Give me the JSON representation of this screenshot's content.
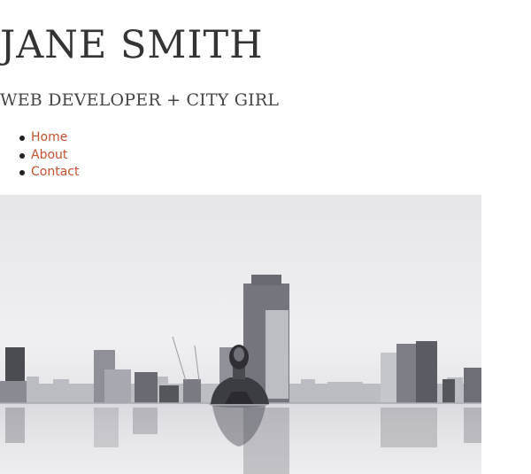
{
  "header": {
    "title": "JANE SMITH",
    "tagline": "WEB DEVELOPER + CITY GIRL"
  },
  "nav": {
    "items": [
      {
        "label": "Home"
      },
      {
        "label": "About"
      },
      {
        "label": "Contact"
      }
    ]
  },
  "hero": {
    "icon": "photo-woman-in-infinity-pool-city-skyline"
  },
  "colors": {
    "link": "#c4512f",
    "text": "#333333",
    "background": "#ffffff"
  }
}
